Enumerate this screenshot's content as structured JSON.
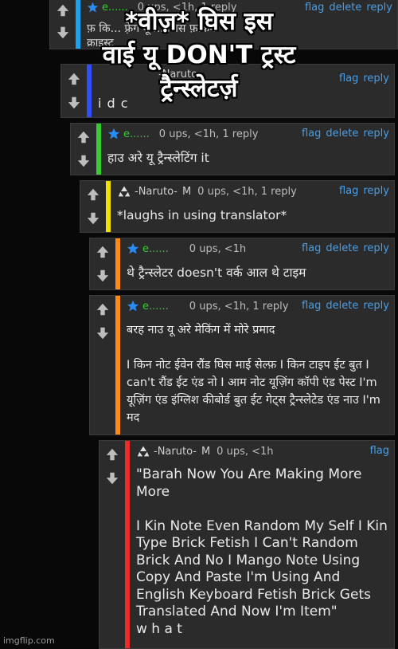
{
  "colors": {
    "bar_blue": "#19a3f0",
    "bar_dark_blue": "#2f4fff",
    "bar_green": "#33cc33",
    "bar_yellow": "#f2e100",
    "bar_orange": "#ff8a1a",
    "bar_red": "#ee2b2b",
    "link": "#4a9ee6"
  },
  "overlay": {
    "line1": "*वीज़* घिस इस",
    "line2": "वाई यू DON'T ट्रस्ट",
    "line3": "ट्रैन्स्लेटर्ज़"
  },
  "comments": [
    {
      "user": "e......",
      "stats": "0 ups, <1h, 1 reply",
      "actions": [
        "flag",
        "delete",
        "reply"
      ],
      "text": "फ़ कि... फ़्रेंग यू ... जिस फ़किंग\nक्राइस्ट"
    },
    {
      "user": "-Naruto-",
      "stats": "",
      "actions": [
        "flag",
        "reply"
      ],
      "text": "i d c"
    },
    {
      "user": "e......",
      "stats": "0 ups, <1h, 1 reply",
      "actions": [
        "flag",
        "delete",
        "reply"
      ],
      "text": "हाउ अरे यू ट्रैन्स्लेटिंग it"
    },
    {
      "user": "-Naruto-",
      "badge": "M",
      "stats": "0 ups, <1h, 1 reply",
      "actions": [
        "flag",
        "reply"
      ],
      "text": "*laughs in using translator*"
    },
    {
      "user": "e......",
      "stats": "0 ups, <1h",
      "actions": [
        "flag",
        "delete",
        "reply"
      ],
      "text": "थे ट्रैन्स्लेटर doesn't वर्क आल थे टाइम"
    },
    {
      "user": "e......",
      "stats": "0 ups, <1h, 1 reply",
      "actions": [
        "flag",
        "delete",
        "reply"
      ],
      "text": "बरह नाउ यू अरे मेकिंग में मोरे प्रमाद\n\nI किन नोट ईवेन रौंड घिस माई सेल्फ़ I किन टाइप ईट बुत I can't रौंड ईट एंड नो I आम नोट यूज़िंग कॉपी एंड पेस्ट I'm यूज़िंग एंड इंग्लिश कीबोर्ड बुत ईट गेट्स ट्रैन्स्लेटेड एंड नाउ I'm मद"
    },
    {
      "user": "-Naruto-",
      "badge": "M",
      "stats": "0 ups, <1h",
      "actions": [
        "flag"
      ],
      "text": "\"Barah Now You Are Making More More\n\nI Kin Note Even Random My Self I Kin Type Brick Fetish I Can't Random Brick And No I Mango Note Using Copy And Paste I'm Using And English Keyboard Fetish Brick Gets Translated And Now I'm Item\"\nw h a t"
    }
  ],
  "watermark": "imgflip.com"
}
